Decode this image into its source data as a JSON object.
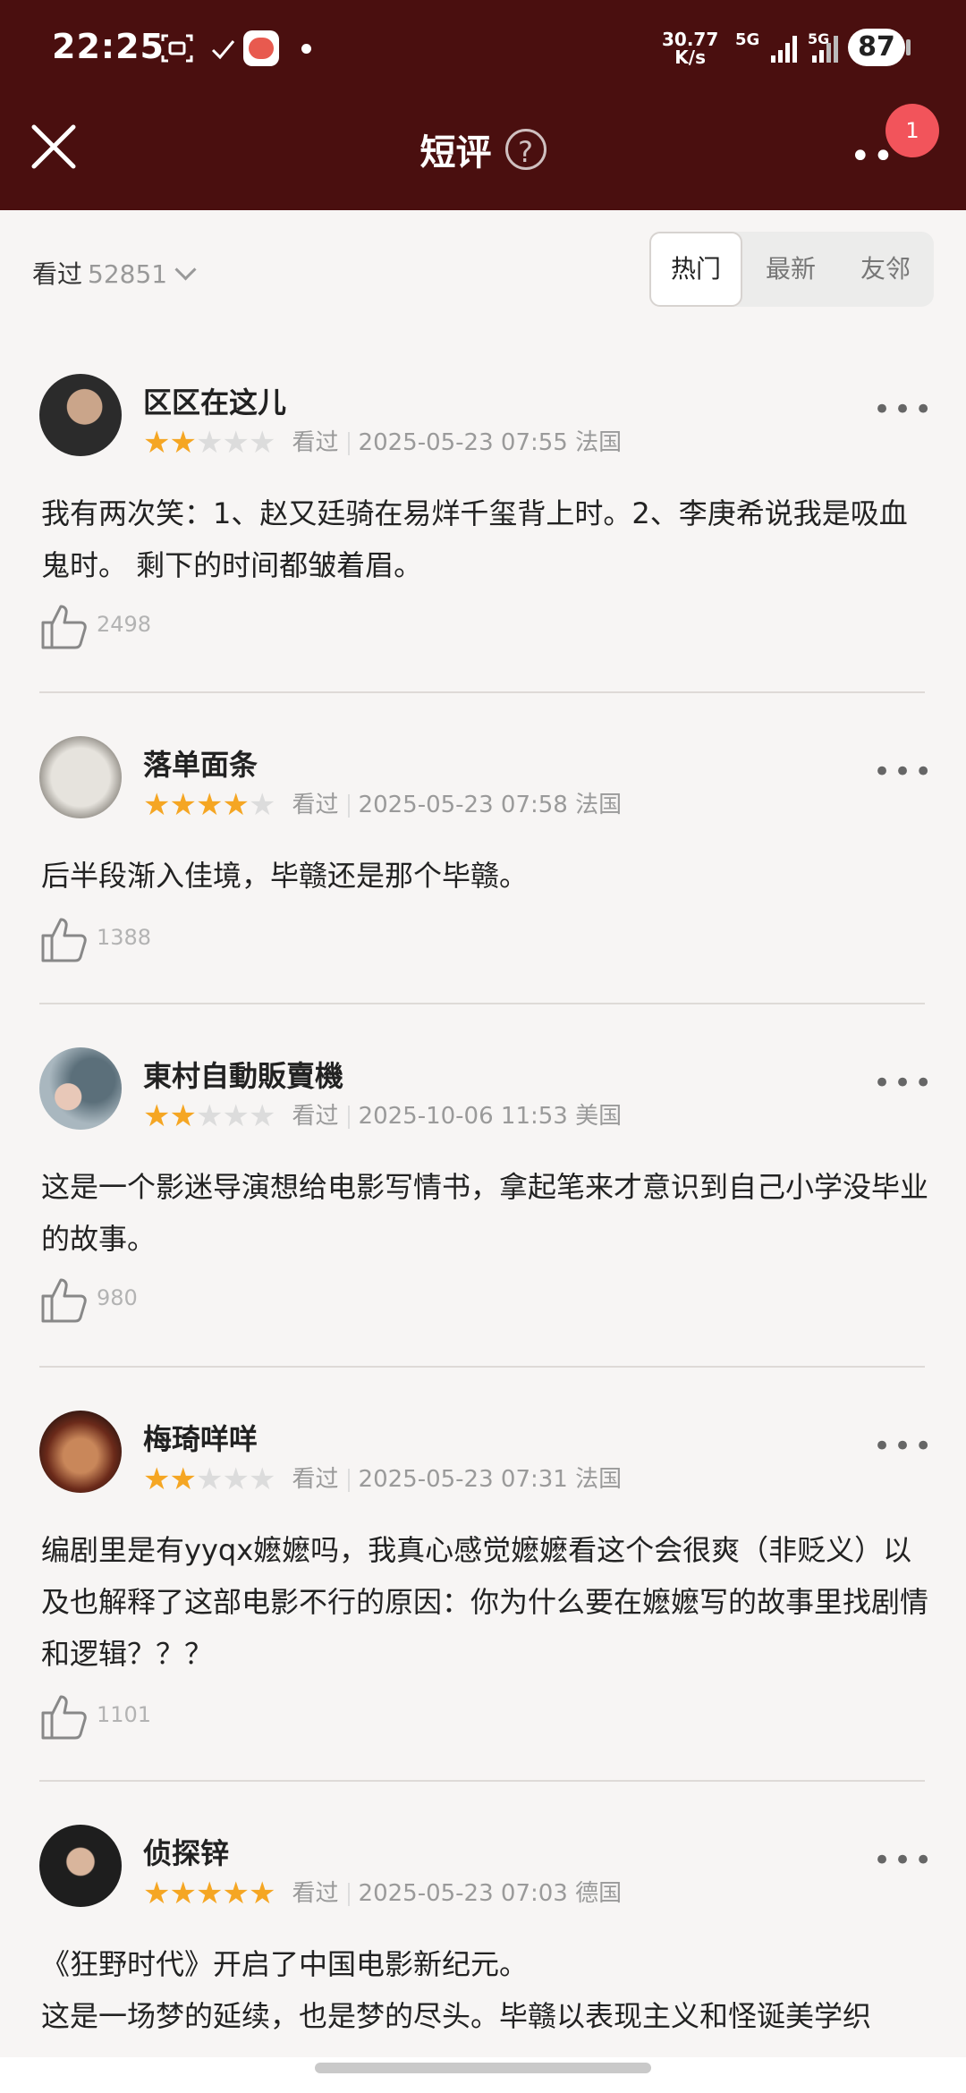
{
  "status_bar": {
    "time": "22:25",
    "net_speed_value": "30.77",
    "net_speed_unit": "K/s",
    "sim1_label": "5G",
    "sim2_label": "5G",
    "battery": "87",
    "icons": [
      "screenshot-icon",
      "check-icon",
      "app-badge-icon",
      "dot-icon",
      "signal-icon",
      "signal-icon"
    ]
  },
  "header": {
    "title": "短评",
    "help_symbol": "?",
    "notification_count": "1",
    "colors": {
      "background": "#4a0f0f",
      "badge": "#f2545b"
    }
  },
  "filter": {
    "watched_label": "看过",
    "watched_count": "52851",
    "tabs": [
      "热门",
      "最新",
      "友邻"
    ],
    "active_tab": "热门"
  },
  "reviews": [
    {
      "user": "区区在这儿",
      "stars": 2,
      "status": "看过",
      "date": "2025-05-23 07:55",
      "location": "法国",
      "content": "我有两次笑：1、赵又廷骑在易烊千玺背上时。2、李庚希说我是吸血鬼时。 剩下的时间都皱着眉。",
      "likes": "2498"
    },
    {
      "user": "落单面条",
      "stars": 4,
      "status": "看过",
      "date": "2025-05-23 07:58",
      "location": "法国",
      "content": "后半段渐入佳境，毕赣还是那个毕赣。",
      "likes": "1388"
    },
    {
      "user": "東村自動販賣機",
      "stars": 2,
      "status": "看过",
      "date": "2025-10-06 11:53",
      "location": "美国",
      "content": "这是一个影迷导演想给电影写情书，拿起笔来才意识到自己小学没毕业的故事。",
      "likes": "980"
    },
    {
      "user": "梅琦咩咩",
      "stars": 2,
      "status": "看过",
      "date": "2025-05-23 07:31",
      "location": "法国",
      "content": "编剧里是有yyqx嬷嬷吗，我真心感觉嬷嬷看这个会很爽（非贬义）以及也解释了这部电影不行的原因：你为什么要在嬷嬷写的故事里找剧情和逻辑？？？",
      "likes": "1101"
    },
    {
      "user": "侦探锌",
      "stars": 5,
      "status": "看过",
      "date": "2025-05-23 07:03",
      "location": "德国",
      "content": "《狂野时代》开启了中国电影新纪元。\n这是一场梦的延续，也是梦的尽头。毕赣以表现主义和怪诞美学织",
      "likes": ""
    }
  ],
  "star_color": "#f5a623"
}
